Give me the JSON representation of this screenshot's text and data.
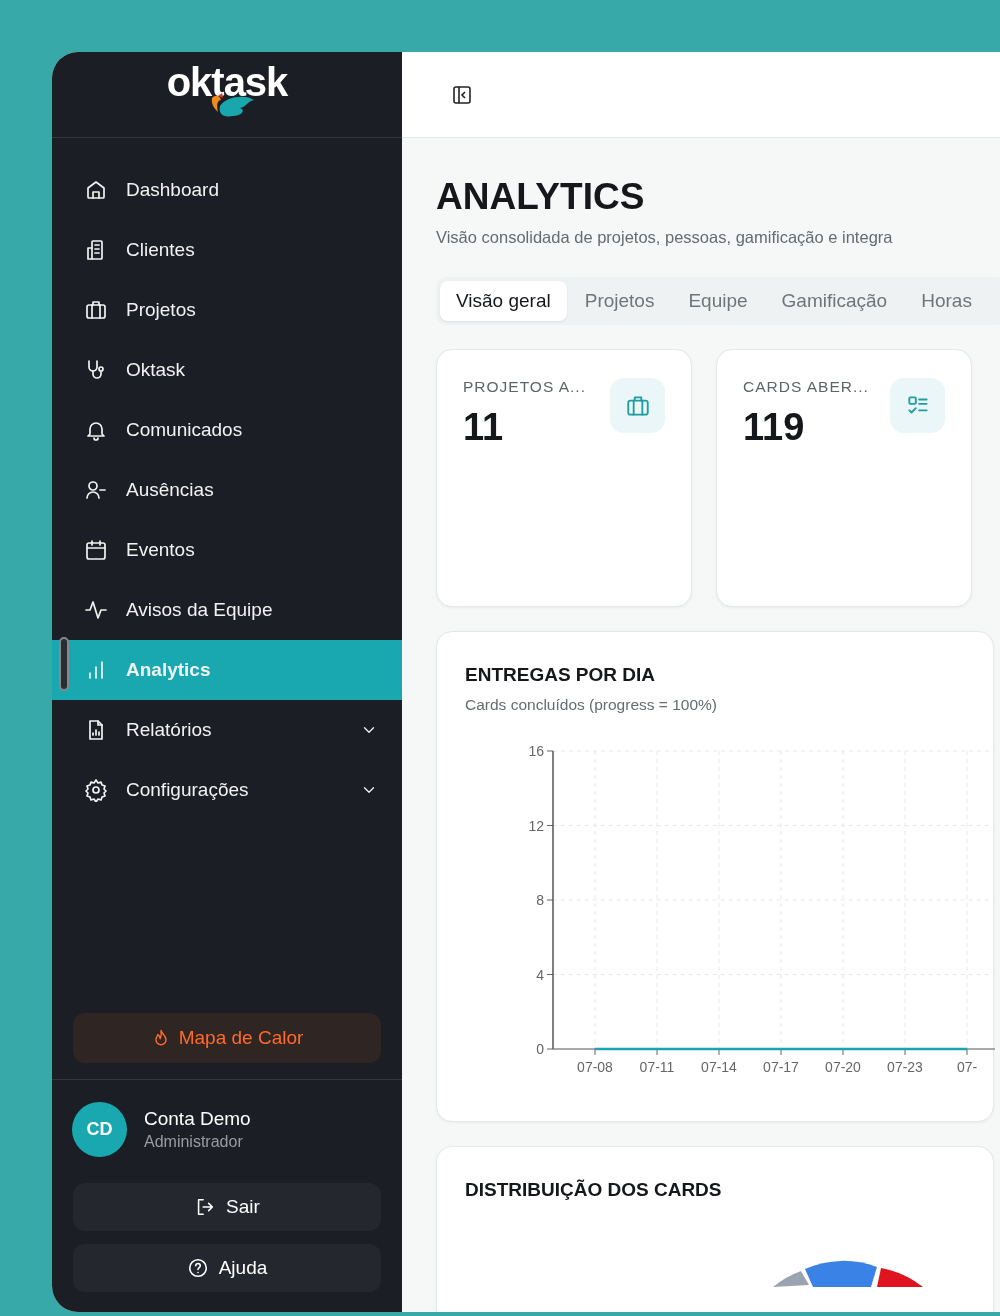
{
  "sidebar": {
    "logo": "oktask",
    "items": [
      {
        "label": "Dashboard",
        "kind": "home",
        "selected": false,
        "expandable": false
      },
      {
        "label": "Clientes",
        "kind": "building",
        "selected": false,
        "expandable": false
      },
      {
        "label": "Projetos",
        "kind": "briefcase",
        "selected": false,
        "expandable": false
      },
      {
        "label": "Oktask",
        "kind": "stethoscope",
        "selected": false,
        "expandable": false
      },
      {
        "label": "Comunicados",
        "kind": "bell",
        "selected": false,
        "expandable": false
      },
      {
        "label": "Ausências",
        "kind": "user-minus",
        "selected": false,
        "expandable": false
      },
      {
        "label": "Eventos",
        "kind": "calendar",
        "selected": false,
        "expandable": false
      },
      {
        "label": "Avisos da Equipe",
        "kind": "activity",
        "selected": false,
        "expandable": false
      },
      {
        "label": "Analytics",
        "kind": "bars",
        "selected": true,
        "expandable": false
      },
      {
        "label": "Relatórios",
        "kind": "file-chart",
        "selected": false,
        "expandable": true
      },
      {
        "label": "Configurações",
        "kind": "gear",
        "selected": false,
        "expandable": true
      }
    ],
    "heatmap_button": "Mapa de Calor",
    "user": {
      "initials": "CD",
      "name": "Conta Demo",
      "role": "Administrador"
    },
    "buttons": [
      {
        "label": "Sair",
        "kind": "logout"
      },
      {
        "label": "Ajuda",
        "kind": "help"
      }
    ]
  },
  "page": {
    "title": "ANALYTICS",
    "subtitle": "Visão consolidada de projetos, pessoas, gamificação e integra",
    "tabs": [
      {
        "label": "Visão geral",
        "selected": true
      },
      {
        "label": "Projetos",
        "selected": false
      },
      {
        "label": "Equipe",
        "selected": false
      },
      {
        "label": "Gamificação",
        "selected": false
      },
      {
        "label": "Horas",
        "selected": false
      }
    ],
    "stats": [
      {
        "label": "PROJETOS A...",
        "value": "11",
        "kind": "briefcase"
      },
      {
        "label": "CARDS ABER...",
        "value": "119",
        "kind": "checklist"
      }
    ],
    "deliveries": {
      "title": "ENTREGAS POR DIA",
      "subtitle": "Cards concluídos (progress = 100%)",
      "chart_data": {
        "type": "line",
        "categories": [
          "07-08",
          "07-11",
          "07-14",
          "07-17",
          "07-20",
          "07-23",
          "07-"
        ],
        "values": [
          0,
          0,
          0,
          0,
          0,
          0,
          0
        ],
        "ylim": [
          0,
          16
        ],
        "yticks": [
          0,
          4,
          8,
          12,
          16
        ],
        "grid": true
      }
    },
    "distribution": {
      "title": "DISTRIBUIÇÃO DOS CARDS"
    }
  }
}
